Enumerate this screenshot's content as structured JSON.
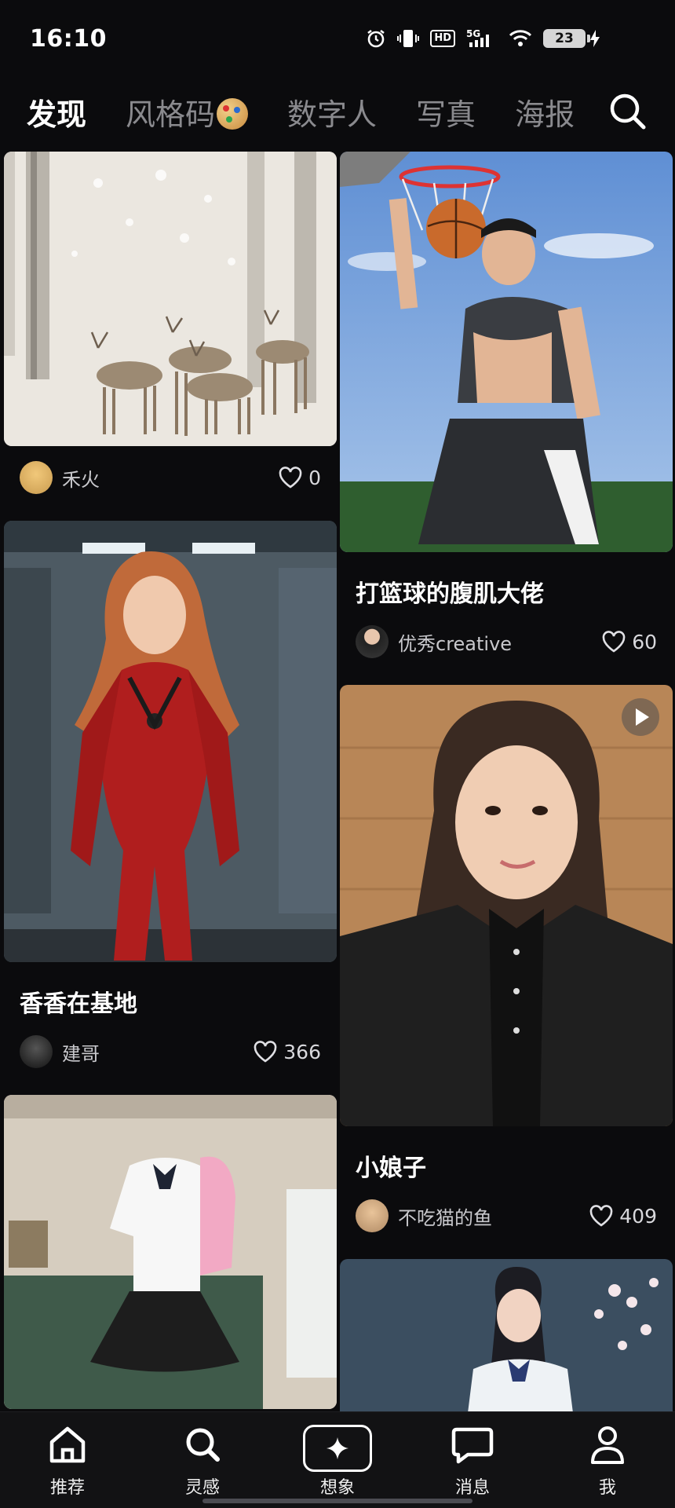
{
  "status": {
    "time": "16:10",
    "battery": "23"
  },
  "tabs": [
    {
      "label": "发现"
    },
    {
      "label": "风格码"
    },
    {
      "label": "数字人"
    },
    {
      "label": "写真"
    },
    {
      "label": "海报"
    }
  ],
  "feed": {
    "left": [
      {
        "title": "",
        "user": "禾火",
        "likes": "0"
      },
      {
        "title": "香香在基地",
        "user": "建哥",
        "likes": "366"
      },
      {
        "title": "",
        "user": "",
        "likes": ""
      }
    ],
    "right": [
      {
        "title": "打篮球的腹肌大佬",
        "user": "优秀creative",
        "likes": "60"
      },
      {
        "title": "小娘子",
        "user": "不吃猫的鱼",
        "likes": "409"
      },
      {
        "title": "",
        "user": "",
        "likes": ""
      }
    ]
  },
  "nav": [
    {
      "label": "推荐"
    },
    {
      "label": "灵感"
    },
    {
      "label": "想象"
    },
    {
      "label": "消息"
    },
    {
      "label": "我"
    }
  ],
  "colors": {
    "background": "#0b0b0d",
    "active_tab": "#ffffff",
    "inactive_tab": "#8a8a8e"
  }
}
